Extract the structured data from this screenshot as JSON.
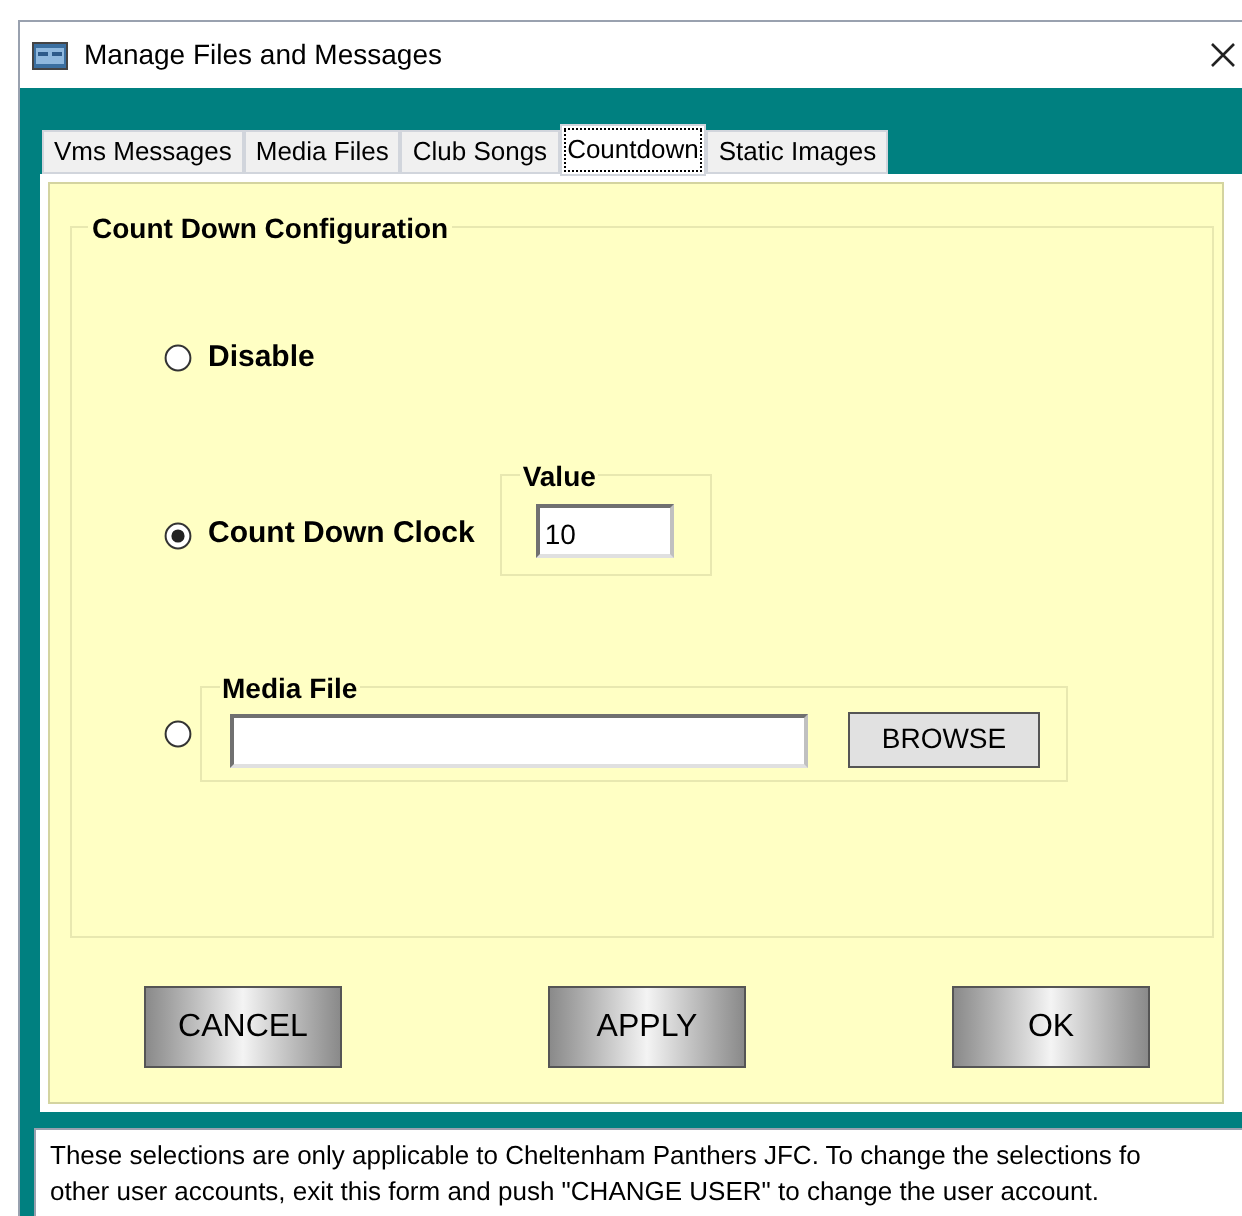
{
  "window": {
    "title": "Manage Files and Messages"
  },
  "tabs": [
    {
      "label": "Vms Messages",
      "selected": false
    },
    {
      "label": "Media Files",
      "selected": false
    },
    {
      "label": "Club Songs",
      "selected": false
    },
    {
      "label": "Countdown",
      "selected": true
    },
    {
      "label": "Static Images",
      "selected": false
    }
  ],
  "group": {
    "title": "Count Down Configuration"
  },
  "options": [
    {
      "kind": "plain",
      "label": "Disable",
      "selected": false
    },
    {
      "kind": "value",
      "label": "Count Down Clock",
      "selected": true,
      "group_title": "Value",
      "value": "10"
    },
    {
      "kind": "file",
      "selected": false,
      "group_title": "Media File",
      "button": "BROWSE"
    }
  ],
  "buttons": [
    "CANCEL",
    "APPLY",
    "OK"
  ],
  "status_lines": [
    "These selections are only applicable to Cheltenham Panthers JFC. To change the selections fo",
    "other user accounts, exit this form and push \"CHANGE USER\" to change the user account."
  ]
}
